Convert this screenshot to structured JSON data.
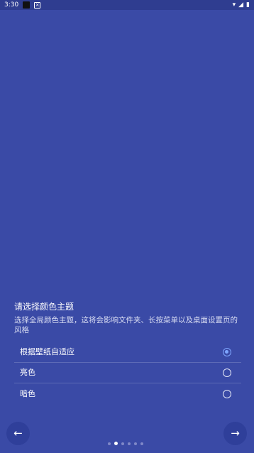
{
  "status_bar": {
    "time": "3:30",
    "icons": [
      "square-icon",
      "notification-badge-icon",
      "wifi-icon",
      "signal-icon",
      "battery-icon"
    ]
  },
  "onboarding": {
    "title": "请选择颜色主题",
    "description": "选择全局颜色主题，这将会影响文件夹、长按菜单以及桌面设置页的风格",
    "options": [
      {
        "label": "根据壁纸自适应",
        "selected": true
      },
      {
        "label": "亮色",
        "selected": false
      },
      {
        "label": "暗色",
        "selected": false
      }
    ],
    "pager": {
      "count": 6,
      "active_index": 1
    }
  },
  "navigation": {
    "prev_icon": "arrow-left-icon",
    "next_icon": "arrow-right-icon"
  },
  "colors": {
    "background": "#3A4AA6",
    "status_bar": "#2F3D90",
    "accent": "#7FA6FF"
  }
}
